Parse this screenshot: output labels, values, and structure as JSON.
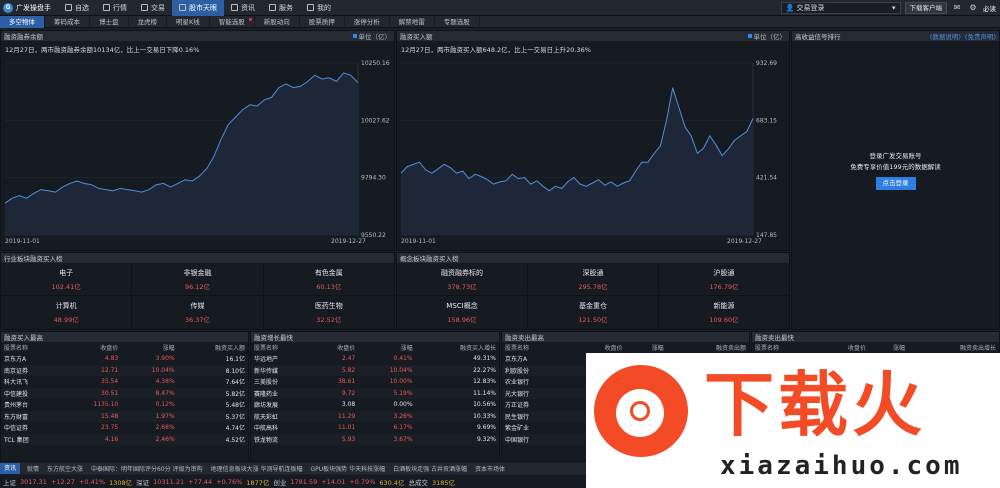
{
  "app": {
    "title": "广发操盘手"
  },
  "nav": [
    {
      "label": "自选",
      "icon": "star-icon"
    },
    {
      "label": "行情",
      "icon": "chart-icon"
    },
    {
      "label": "交易",
      "icon": "trade-icon"
    },
    {
      "label": "股市天眼",
      "icon": "eye-icon",
      "active": true
    },
    {
      "label": "资讯",
      "icon": "news-icon"
    },
    {
      "label": "服务",
      "icon": "service-icon"
    },
    {
      "label": "我的",
      "icon": "user-icon"
    }
  ],
  "topright": {
    "login_label": "交易登录",
    "client_button": "下载客户端",
    "must_read": "必读"
  },
  "tabs": [
    {
      "label": "多空物体",
      "active": true
    },
    {
      "label": "筹码成本"
    },
    {
      "label": "博士盘"
    },
    {
      "label": "龙虎榜"
    },
    {
      "label": "明星K线"
    },
    {
      "label": "智能选股",
      "dot": true
    },
    {
      "label": "新股动向"
    },
    {
      "label": "股票质押"
    },
    {
      "label": "涨停分析"
    },
    {
      "label": "解禁地雷"
    },
    {
      "label": "专题选股"
    }
  ],
  "panel_balance": {
    "title": "融资融券余额",
    "unit": "单位（亿）",
    "summary": "12月27日，两市融资融券余额10134亿，比上一交易日下降0.16%",
    "x_start": "2019-11-01",
    "x_end": "2019-12-27",
    "y_ticks": [
      "10250.16",
      "10027.62",
      "9794.30",
      "9550.22"
    ]
  },
  "panel_buy": {
    "title": "融资买入额",
    "unit": "单位（亿）",
    "summary": "12月27日，两市融资买入额648.2亿，比上一交易日上升20.36%",
    "x_start": "2019-11-01",
    "x_end": "2019-12-27",
    "y_ticks": [
      "932.69",
      "683.15",
      "421.54",
      "147.85"
    ]
  },
  "panel_signal": {
    "title": "高收益信号排行",
    "links": [
      "(数据说明)",
      "(免责声明)"
    ],
    "login_line1": "登录广发交易账号",
    "login_line2": "免费专享价值199元的数据解读",
    "login_button": "点击登录"
  },
  "chart_data": [
    {
      "type": "line",
      "title": "融资融券余额",
      "ylim": [
        9550.22,
        10250.16
      ],
      "x": [
        "2019-11-01",
        "2019-12-27"
      ],
      "series": [
        {
          "values": [
            9680,
            9700,
            9710,
            9700,
            9720,
            9735,
            9730,
            9725,
            9745,
            9760,
            9770,
            9760,
            9755,
            9740,
            9735,
            9730,
            9740,
            9735,
            9730,
            9725,
            9735,
            9755,
            9760,
            9745,
            9760,
            9775,
            9770,
            9790,
            9820,
            9870,
            9940,
            10000,
            10030,
            10060,
            10080,
            10075,
            10100,
            10110,
            10150,
            10165,
            10150,
            10155,
            10175,
            10200,
            10185,
            10190,
            10175,
            10210,
            10200,
            10170
          ]
        }
      ]
    },
    {
      "type": "line",
      "title": "融资买入额",
      "ylim": [
        147.85,
        932.69
      ],
      "x": [
        "2019-11-01",
        "2019-12-27"
      ],
      "series": [
        {
          "values": [
            430,
            460,
            470,
            480,
            445,
            430,
            450,
            470,
            455,
            430,
            440,
            405,
            425,
            415,
            400,
            380,
            390,
            395,
            425,
            405,
            410,
            380,
            395,
            370,
            350,
            370,
            360,
            390,
            410,
            380,
            370,
            385,
            400,
            375,
            390,
            370,
            385,
            395,
            440,
            480,
            480,
            520,
            555,
            670,
            820,
            730,
            640,
            600,
            520,
            545,
            600,
            560,
            510,
            540,
            580,
            600,
            620,
            680
          ]
        }
      ]
    }
  ],
  "industry": {
    "title": "行业板块融资买入榜",
    "items": [
      {
        "name": "电子",
        "value": "102.41亿"
      },
      {
        "name": "非银金融",
        "value": "96.12亿"
      },
      {
        "name": "有色金属",
        "value": "60.13亿"
      },
      {
        "name": "计算机",
        "value": "48.99亿"
      },
      {
        "name": "传媒",
        "value": "36.37亿"
      },
      {
        "name": "医药生物",
        "value": "32.52亿"
      }
    ]
  },
  "concept": {
    "title": "概念板块融资买入榜",
    "items": [
      {
        "name": "融资融券标的",
        "value": "378.73亿"
      },
      {
        "name": "深股通",
        "value": "295.78亿"
      },
      {
        "name": "沪股通",
        "value": "176.79亿"
      },
      {
        "name": "MSCI概念",
        "value": "158.96亿"
      },
      {
        "name": "基金重仓",
        "value": "121.50亿"
      },
      {
        "name": "新能源",
        "value": "109.60亿"
      }
    ]
  },
  "table_buy": {
    "title": "融资买入最高",
    "headers": [
      "股票名称",
      "收盘价",
      "涨幅",
      "融资买入额"
    ],
    "rows": [
      [
        "京东方A",
        "4.83",
        "3.90%",
        "16.1亿"
      ],
      [
        "南京证券",
        "12.71",
        "10.04%",
        "8.10亿"
      ],
      [
        "科大讯飞",
        "35.54",
        "4.38%",
        "7.64亿"
      ],
      [
        "中信建投",
        "30.51",
        "8.47%",
        "5.82亿"
      ],
      [
        "贵州茅台",
        "1135.10",
        "0.12%",
        "5.48亿"
      ],
      [
        "东方财富",
        "15.48",
        "1.97%",
        "5.37亿"
      ],
      [
        "中信证券",
        "23.75",
        "2.68%",
        "4.74亿"
      ],
      [
        "TCL 集团",
        "4.16",
        "2.46%",
        "4.52亿"
      ]
    ]
  },
  "table_growth": {
    "title": "融资增长最快",
    "headers": [
      "股票名称",
      "收盘价",
      "涨幅",
      "融资买入增长"
    ],
    "rows": [
      [
        "华远地产",
        "2.47",
        "0.41%",
        "49.31%"
      ],
      [
        "新华传媒",
        "5.82",
        "10.04%",
        "22.27%"
      ],
      [
        "三美股份",
        "38.61",
        "10.00%",
        "12.83%"
      ],
      [
        "赛隆药业",
        "9.72",
        "5.19%",
        "11.14%"
      ],
      [
        "廊坊发展",
        "3.08",
        "0.00%",
        "10.56%"
      ],
      [
        "航天彩虹",
        "11.29",
        "3.26%",
        "10.33%"
      ],
      [
        "中航高科",
        "11.01",
        "6.17%",
        "9.69%"
      ],
      [
        "铁龙物流",
        "5.93",
        "3.67%",
        "9.32%"
      ]
    ]
  },
  "table_sell": {
    "title": "融资卖出最高",
    "headers": [
      "股票名称",
      "收盘价",
      "涨幅",
      "融资卖出额"
    ],
    "rows": [
      [
        "京东方A",
        "",
        "",
        ""
      ],
      [
        "利欧股份",
        "",
        "",
        ""
      ],
      [
        "农业银行",
        "",
        "",
        ""
      ],
      [
        "光大银行",
        "",
        "",
        ""
      ],
      [
        "方正证券",
        "",
        "",
        ""
      ],
      [
        "民生银行",
        "",
        "",
        ""
      ],
      [
        "紫金矿业",
        "",
        "",
        ""
      ],
      [
        "中国银行",
        "",
        "",
        ""
      ]
    ]
  },
  "table_sellfast": {
    "title": "融资卖出最快",
    "headers": [
      "股票名称",
      "收盘价",
      "涨幅",
      "融资卖出增长"
    ],
    "rows": [
      [
        "",
        "",
        "",
        ""
      ],
      [
        "",
        "",
        "",
        ""
      ],
      [
        "",
        "",
        "",
        ""
      ],
      [
        "",
        "",
        "",
        ""
      ],
      [
        "",
        "",
        "",
        ""
      ],
      [
        "",
        "",
        "",
        ""
      ],
      [
        "",
        "",
        "",
        ""
      ],
      [
        "",
        "",
        "",
        ""
      ]
    ]
  },
  "news": {
    "tag": "资讯",
    "items": [
      "就情",
      "东方航空大涨",
      "中泰国际：明年国际评分60分 评级为审构",
      "地理信息板块大涨 华测导航连板幅",
      "GPU板块强势 华天科技涨幅",
      "白酒板块走强 古井贡酒涨幅",
      "资本市场体"
    ]
  },
  "status": [
    {
      "label": "上证",
      "index": "3017.31",
      "change": "+12.27",
      "pct": "+0.41%",
      "vol": "1308亿"
    },
    {
      "label": "深证",
      "index": "10311.21",
      "change": "+77.44",
      "pct": "+0.76%",
      "vol": "1877亿"
    },
    {
      "label": "创业",
      "index": "1781.59",
      "change": "+14.01",
      "pct": "+0.79%",
      "vol": "630.4亿"
    },
    {
      "label": "总成交",
      "index": "",
      "change": "",
      "pct": "",
      "vol": "3185亿"
    }
  ],
  "watermark": {
    "main": "下载火",
    "sub": "xiazaihuo.com"
  },
  "colors": {
    "accent": "#2d5fa5",
    "up": "#e85a5a",
    "line": "#4f8fe0"
  }
}
